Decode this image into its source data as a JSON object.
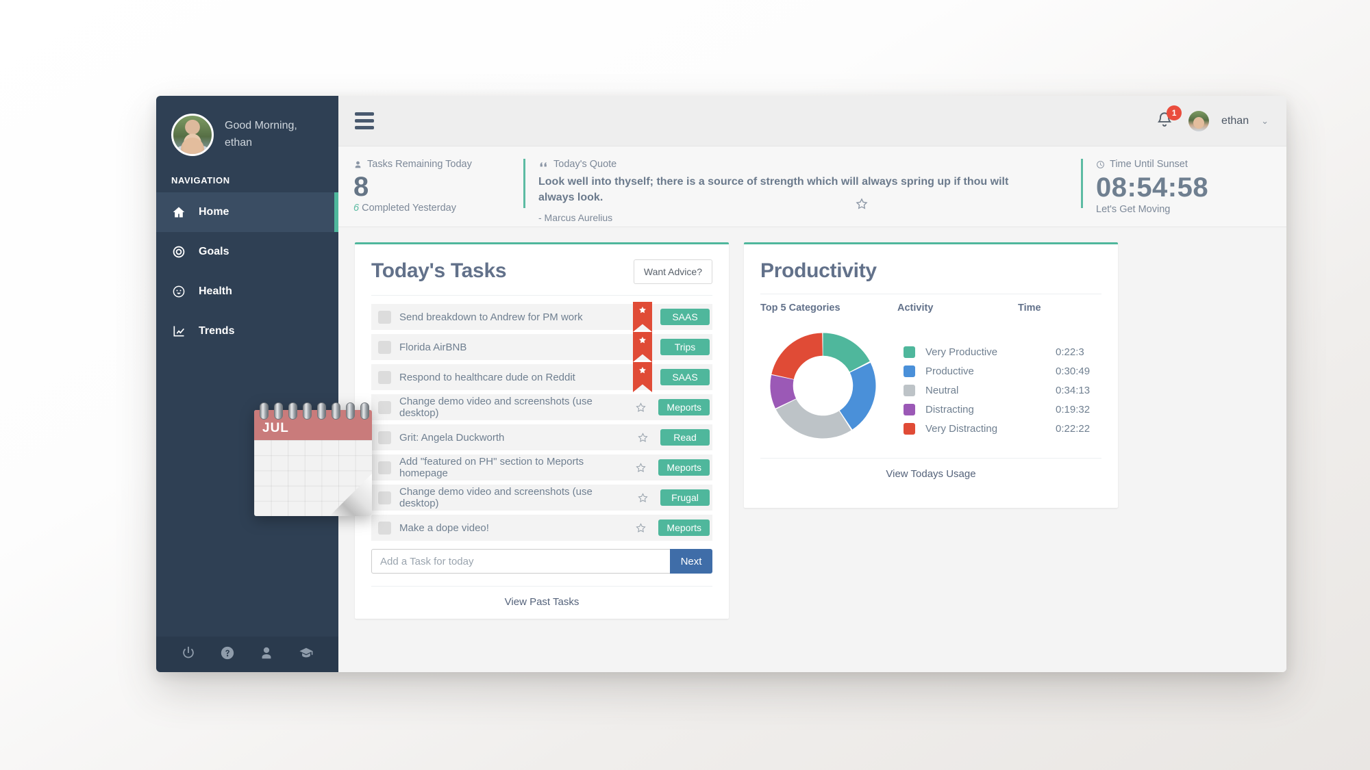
{
  "sidebar": {
    "greeting_line1": "Good Morning,",
    "greeting_line2": "ethan",
    "nav_title": "NAVIGATION",
    "items": [
      {
        "label": "Home",
        "icon": "home-icon",
        "active": true
      },
      {
        "label": "Goals",
        "icon": "target-icon",
        "active": false
      },
      {
        "label": "Health",
        "icon": "smiley-icon",
        "active": false
      },
      {
        "label": "Trends",
        "icon": "chart-icon",
        "active": false
      }
    ],
    "footer_icons": [
      "power-icon",
      "help-icon",
      "user-icon",
      "graduation-cap-icon"
    ],
    "decoration": "calendar-image",
    "calendar_month": "JUL"
  },
  "topbar": {
    "menu_icon": "hamburger-icon",
    "bell_icon": "bell-icon",
    "notification_count": "1",
    "username": "ethan",
    "caret": "⌄"
  },
  "stats": {
    "tasks": {
      "icon": "person-icon",
      "label": "Tasks Remaining Today",
      "value": "8",
      "completed_count": "6",
      "completed_label": "Completed Yesterday"
    },
    "quote": {
      "icon": "quote-icon",
      "label": "Today's Quote",
      "text": "Look well into thyself; there is a source of strength which will always spring up if thou wilt always look.",
      "author": "- Marcus Aurelius",
      "favorite_icon": "star-outline-icon"
    },
    "sunset": {
      "icon": "clock-icon",
      "label": "Time Until Sunset",
      "value": "08:54:58",
      "sub": "Let's Get Moving"
    }
  },
  "tasks_card": {
    "title": "Today's Tasks",
    "advice_button": "Want Advice?",
    "rows": [
      {
        "text": "Send breakdown to Andrew for PM work",
        "flagged": true,
        "tag": "SAAS"
      },
      {
        "text": "Florida AirBNB",
        "flagged": true,
        "tag": "Trips"
      },
      {
        "text": "Respond to healthcare dude on Reddit",
        "flagged": true,
        "tag": "SAAS"
      },
      {
        "text": "Change demo video and screenshots (use desktop)",
        "flagged": false,
        "tag": "Meports"
      },
      {
        "text": "Grit: Angela Duckworth",
        "flagged": false,
        "tag": "Read"
      },
      {
        "text": "Add \"featured on PH\" section to Meports homepage",
        "flagged": false,
        "tag": "Meports"
      },
      {
        "text": "Change demo video and screenshots (use desktop)",
        "flagged": false,
        "tag": "Frugal"
      },
      {
        "text": "Make a dope video!",
        "flagged": false,
        "tag": "Meports"
      }
    ],
    "input_placeholder": "Add a Task for today",
    "input_value": "",
    "next_button": "Next",
    "footer_link": "View Past Tasks"
  },
  "productivity_card": {
    "title": "Productivity",
    "columns": [
      "Top 5 Categories",
      "Activity",
      "Time"
    ],
    "footer_link": "View Todays Usage"
  },
  "chart_data": {
    "type": "pie",
    "title": "Productivity",
    "subtitle": "Top 5 Categories",
    "legend_position": "right",
    "labels": [
      "Very Productive",
      "Productive",
      "Neutral",
      "Distracting",
      "Very Distracting"
    ],
    "values": [
      22.5,
      30.82,
      34.22,
      19.53,
      22.37
    ],
    "display_times": [
      "0:22:3",
      "0:30:49",
      "0:34:13",
      "0:19:32",
      "0:22:22"
    ],
    "colors": [
      "#4fb79c",
      "#4a90d9",
      "#bdc3c7",
      "#9b59b6",
      "#e04b36"
    ],
    "percentages": [
      17.3,
      23.7,
      26.3,
      15.0,
      17.2
    ],
    "inner_radius_ratio": 0.56
  },
  "colors": {
    "accent_green": "#4fb79c",
    "sidebar_bg": "#2f4054",
    "flag_red": "#e04b36",
    "button_blue": "#3f6da8",
    "badge_red": "#ea4d3d"
  }
}
